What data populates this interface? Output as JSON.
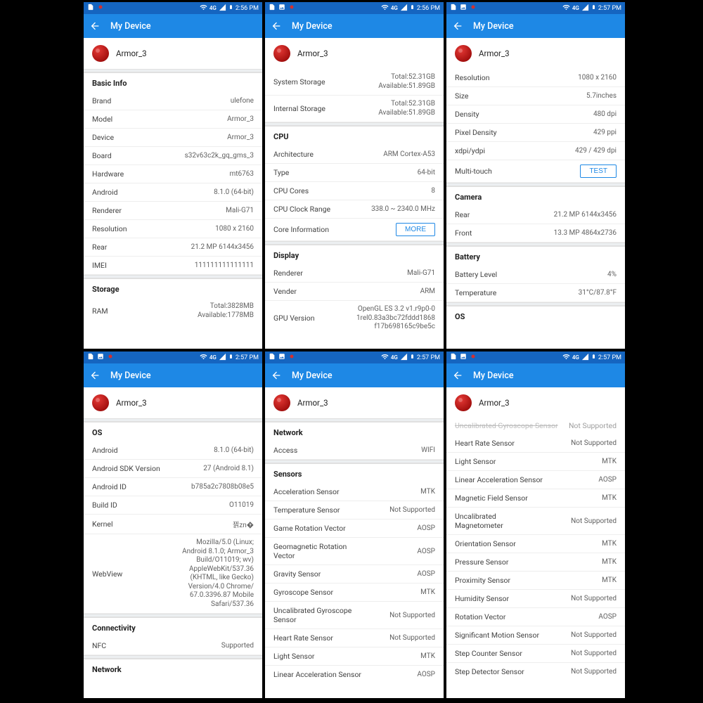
{
  "appbar_title": "My Device",
  "device_name": "Armor_3",
  "times": [
    "2:56 PM",
    "2:56 PM",
    "2:57 PM",
    "2:57 PM",
    "2:57 PM",
    "2:57 PM"
  ],
  "net_label": "4G",
  "screens": [
    {
      "header": true,
      "sections": [
        {
          "title": "Basic Info",
          "rows": [
            {
              "l": "Brand",
              "v": "ulefone"
            },
            {
              "l": "Model",
              "v": "Armor_3"
            },
            {
              "l": "Device",
              "v": "Armor_3"
            },
            {
              "l": "Board",
              "v": "s32v63c2k_gq_gms_3"
            },
            {
              "l": "Hardware",
              "v": "mt6763"
            },
            {
              "l": "Android",
              "v": "8.1.0 (64-bit)"
            },
            {
              "l": "Renderer",
              "v": "Mali-G71"
            },
            {
              "l": "Resolution",
              "v": "1080 x 2160"
            },
            {
              "l": "Rear",
              "v": "21.2 MP 6144x3456"
            },
            {
              "l": "IMEI",
              "v": "111111111111111"
            }
          ]
        },
        {
          "title": "Storage",
          "rows": [
            {
              "l": "RAM",
              "stack": [
                "Total:3828MB",
                "Available:1778MB"
              ]
            }
          ]
        }
      ]
    },
    {
      "header": true,
      "sections": [
        {
          "title": null,
          "rows": [
            {
              "l": "System Storage",
              "stack": [
                "Total:52.31GB",
                "Available:51.89GB"
              ]
            },
            {
              "l": "Internal Storage",
              "stack": [
                "Total:52.31GB",
                "Available:51.89GB"
              ]
            }
          ]
        },
        {
          "title": "CPU",
          "rows": [
            {
              "l": "Architecture",
              "v": "ARM Cortex-A53"
            },
            {
              "l": "Type",
              "v": "64-bit"
            },
            {
              "l": "CPU Cores",
              "v": "8"
            },
            {
              "l": "CPU Clock Range",
              "v": "338.0 ~ 2340.0 MHz"
            },
            {
              "l": "Core Information",
              "btn": "MORE"
            }
          ]
        },
        {
          "title": "Display",
          "rows": [
            {
              "l": "Renderer",
              "v": "Mali-G71"
            },
            {
              "l": "Vender",
              "v": "ARM"
            },
            {
              "l": "GPU Version",
              "stack": [
                "OpenGL ES 3.2 v1.r9p0-0",
                "1rel0.83a3bc72fddd1868",
                "f17b698165c9be5c"
              ]
            }
          ]
        }
      ]
    },
    {
      "header": true,
      "sections": [
        {
          "title": null,
          "rows": [
            {
              "l": "Resolution",
              "v": "1080 x 2160"
            },
            {
              "l": "Size",
              "v": "5.7inches"
            },
            {
              "l": "Density",
              "v": "480 dpi"
            },
            {
              "l": "Pixel Density",
              "v": "429 ppi"
            },
            {
              "l": "xdpi/ydpi",
              "v": "429 / 429 dpi"
            },
            {
              "l": "Multi-touch",
              "btn": "TEST"
            }
          ]
        },
        {
          "title": "Camera",
          "rows": [
            {
              "l": "Rear",
              "v": "21.2 MP 6144x3456"
            },
            {
              "l": "Front",
              "v": "13.3 MP 4864x2736"
            }
          ]
        },
        {
          "title": "Battery",
          "rows": [
            {
              "l": "Battery Level",
              "v": "4%"
            },
            {
              "l": "Temperature",
              "v": "31°C/87.8°F"
            }
          ]
        },
        {
          "title": "OS",
          "rows": []
        }
      ]
    },
    {
      "header": true,
      "sections": [
        {
          "title": "OS",
          "rows": [
            {
              "l": "Android",
              "v": "8.1.0 (64-bit)"
            },
            {
              "l": "Android SDK Version",
              "v": "27 (Android 8.1)"
            },
            {
              "l": "Android ID",
              "v": "b785a2c7808b08e5"
            },
            {
              "l": "Build ID",
              "v": "O11019"
            },
            {
              "l": "Kernel",
              "v": "끩zn�"
            },
            {
              "l": "WebView",
              "stack": [
                "Mozilla/5.0 (Linux;",
                "Android 8.1.0; Armor_3",
                "Build/O11019; wv)",
                "AppleWebKit/537.36",
                "(KHTML, like Gecko)",
                "Version/4.0 Chrome/",
                "67.0.3396.87 Mobile",
                "Safari/537.36"
              ]
            }
          ]
        },
        {
          "title": "Connectivity",
          "rows": [
            {
              "l": "NFC",
              "v": "Supported"
            }
          ]
        },
        {
          "title": "Network",
          "rows": []
        }
      ]
    },
    {
      "header": true,
      "sections": [
        {
          "title": "Network",
          "rows": [
            {
              "l": "Access",
              "v": "WIFI"
            }
          ]
        },
        {
          "title": "Sensors",
          "rows": [
            {
              "l": "Acceleration Sensor",
              "v": "MTK"
            },
            {
              "l": "Temperature Sensor",
              "v": "Not Supported"
            },
            {
              "l": "Game Rotation Vector",
              "v": "AOSP"
            },
            {
              "l": "Geomagnetic Rotation Vector",
              "v": "AOSP"
            },
            {
              "l": "Gravity Sensor",
              "v": "AOSP"
            },
            {
              "l": "Gyroscope Sensor",
              "v": "MTK"
            },
            {
              "l": "Uncalibrated Gyroscope Sensor",
              "v": "Not Supported"
            },
            {
              "l": "Heart Rate Sensor",
              "v": "Not Supported"
            },
            {
              "l": "Light Sensor",
              "v": "MTK"
            },
            {
              "l": "Linear Acceleration Sensor",
              "v": "AOSP"
            }
          ]
        }
      ]
    },
    {
      "header": true,
      "trunc": {
        "l": "Uncalibrated Gyroscope Sensor",
        "v": "Not Supported"
      },
      "sections": [
        {
          "title": null,
          "rows": [
            {
              "l": "Heart Rate Sensor",
              "v": "Not Supported"
            },
            {
              "l": "Light Sensor",
              "v": "MTK"
            },
            {
              "l": "Linear Acceleration Sensor",
              "v": "AOSP"
            },
            {
              "l": "Magnetic Field Sensor",
              "v": "MTK"
            },
            {
              "l": "Uncalibrated Magnetometer",
              "v": "Not Supported"
            },
            {
              "l": "Orientation Sensor",
              "v": "MTK"
            },
            {
              "l": "Pressure Sensor",
              "v": "MTK"
            },
            {
              "l": "Proximity Sensor",
              "v": "MTK"
            },
            {
              "l": "Humidity Sensor",
              "v": "Not Supported"
            },
            {
              "l": "Rotation Vector",
              "v": "AOSP"
            },
            {
              "l": "Significant Motion Sensor",
              "v": "Not Supported"
            },
            {
              "l": "Step Counter Sensor",
              "v": "Not Supported"
            },
            {
              "l": "Step Detector Sensor",
              "v": "Not Supported"
            }
          ]
        }
      ]
    }
  ]
}
